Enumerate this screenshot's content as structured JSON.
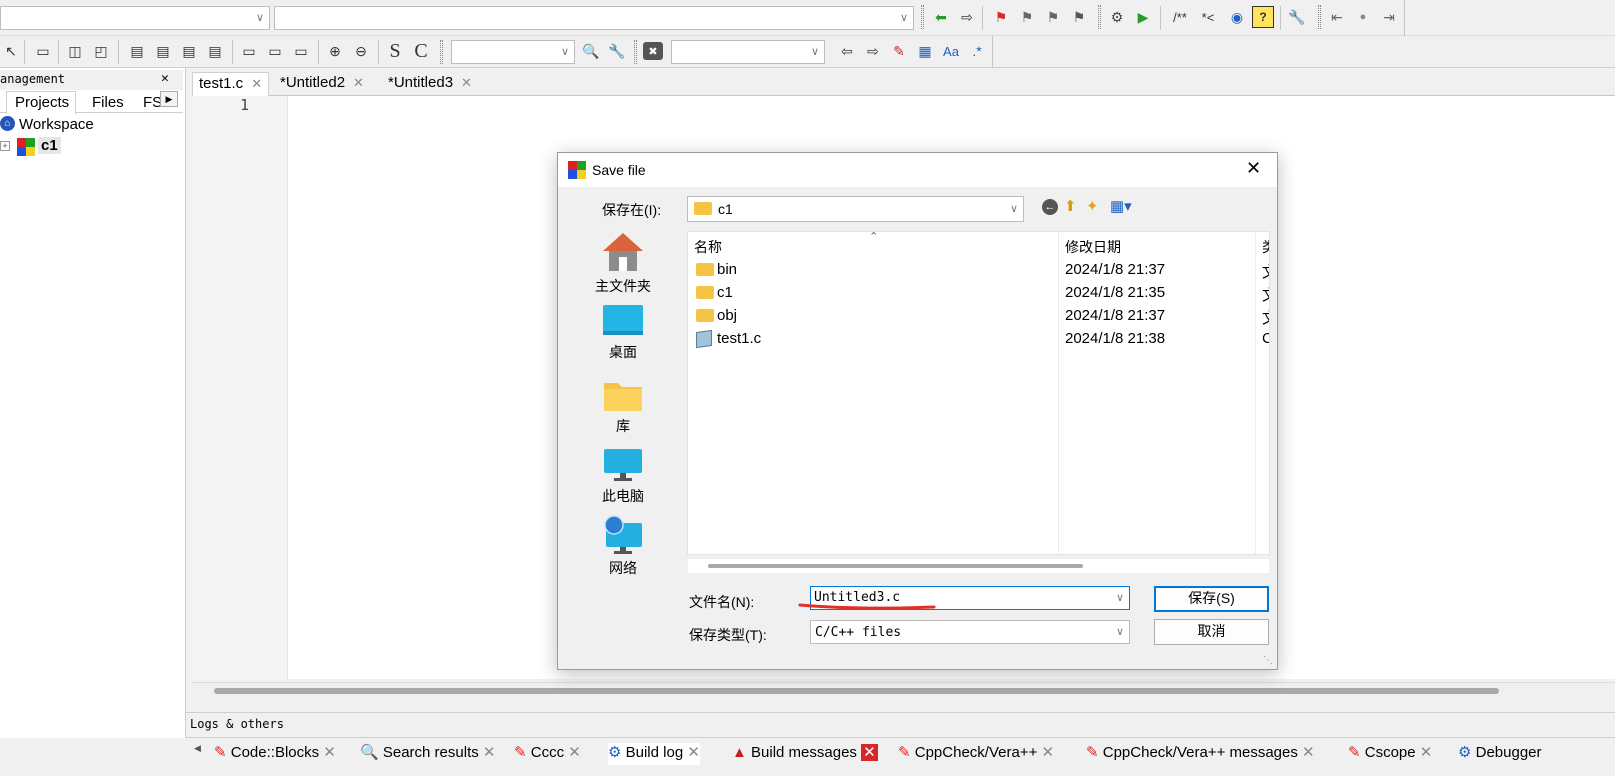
{
  "toolbar": {
    "row1_icons": [
      "arrow-left-green-icon",
      "arrow-right-icon",
      "flag-red-icon",
      "flag-prev-icon",
      "flag-next-icon",
      "flag-clear-icon",
      "build-settings-icon",
      "run-icon",
      "comment-block-label",
      "comment-line-label",
      "browse-icon",
      "help-icon",
      "wrench-icon",
      "step-back-icon",
      "dot-icon",
      "step-forward-icon"
    ],
    "comment_block_label": "/**",
    "comment_line_label": "*<",
    "s_label": "S",
    "c_label": "C",
    "regex_label": ".*",
    "aa_label": "Aa"
  },
  "left_panel": {
    "title": "anagement",
    "close": "✕",
    "tabs": [
      "Projects",
      "Files",
      "FS"
    ],
    "tree": {
      "workspace": "Workspace",
      "project": "c1"
    }
  },
  "editor": {
    "tabs": [
      {
        "label": "test1.c",
        "close": "✕"
      },
      {
        "label": "*Untitled2",
        "close": "✕"
      },
      {
        "label": "*Untitled3",
        "close": "✕"
      }
    ],
    "line_number": "1"
  },
  "logs": {
    "title": "Logs & others",
    "tabs": [
      {
        "label": "Code::Blocks",
        "icon": "edit-icon"
      },
      {
        "label": "Search results",
        "icon": "search-icon"
      },
      {
        "label": "Cccc",
        "icon": "edit-icon"
      },
      {
        "label": "Build log",
        "icon": "gear-icon"
      },
      {
        "label": "Build messages",
        "icon": "build-icon"
      },
      {
        "label": "CppCheck/Vera++",
        "icon": "edit-icon"
      },
      {
        "label": "CppCheck/Vera++ messages",
        "icon": "edit-icon"
      },
      {
        "label": "Cscope",
        "icon": "edit-icon"
      },
      {
        "label": "Debugger",
        "icon": "gear-icon"
      }
    ]
  },
  "dialog": {
    "title": "Save file",
    "look_in_label": "保存在(I):",
    "look_in_value": "c1",
    "places": [
      {
        "label": "主文件夹",
        "icon": "home-icon"
      },
      {
        "label": "桌面",
        "icon": "desktop-icon"
      },
      {
        "label": "库",
        "icon": "library-icon"
      },
      {
        "label": "此电脑",
        "icon": "computer-icon"
      },
      {
        "label": "网络",
        "icon": "network-icon"
      }
    ],
    "columns": {
      "name": "名称",
      "modified": "修改日期",
      "type": "类"
    },
    "files": [
      {
        "name": "bin",
        "modified": "2024/1/8 21:37",
        "type": "文",
        "icon": "folder-icon"
      },
      {
        "name": "c1",
        "modified": "2024/1/8 21:35",
        "type": "文",
        "icon": "folder-icon"
      },
      {
        "name": "obj",
        "modified": "2024/1/8 21:37",
        "type": "文",
        "icon": "folder-icon"
      },
      {
        "name": "test1.c",
        "modified": "2024/1/8 21:38",
        "type": "C",
        "icon": "c-file-icon"
      }
    ],
    "filename_label": "文件名(N):",
    "filename_value": "Untitled3.c",
    "filetype_label": "保存类型(T):",
    "filetype_value": "C/C++ files",
    "save_button": "保存(S)",
    "cancel_button": "取消"
  },
  "colors": {
    "accent_blue": "#0078d7",
    "annotation_red": "#e0302a",
    "folder_yellow": "#f6c444"
  }
}
